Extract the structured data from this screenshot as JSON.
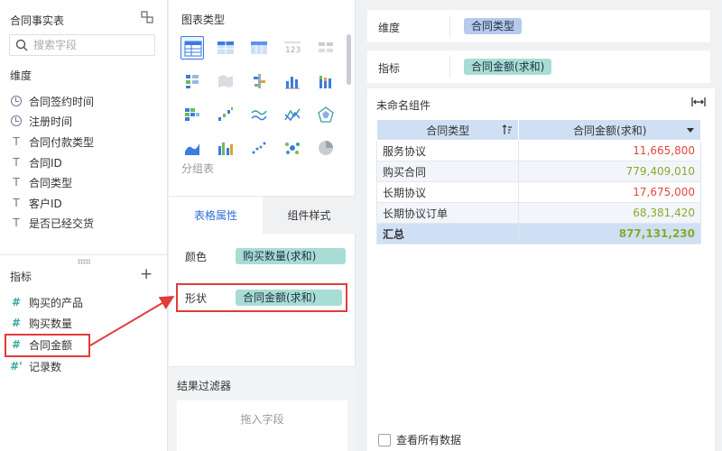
{
  "left": {
    "title": "合同事实表",
    "search_placeholder": "搜索字段",
    "dimension_label": "维度",
    "dimensions": [
      {
        "icon": "clock-icon",
        "label": "合同签约时间"
      },
      {
        "icon": "clock-icon",
        "label": "注册时间"
      },
      {
        "icon": "text-type-icon",
        "label": "合同付款类型"
      },
      {
        "icon": "text-type-icon",
        "label": "合同ID"
      },
      {
        "icon": "text-type-icon",
        "label": "合同类型"
      },
      {
        "icon": "text-type-icon",
        "label": "客户ID"
      },
      {
        "icon": "text-type-icon",
        "label": "是否已经交货"
      }
    ],
    "measure_label": "指标",
    "measures": [
      {
        "icon": "number-type-icon",
        "label": "购买的产品"
      },
      {
        "icon": "number-type-icon",
        "label": "购买数量"
      },
      {
        "icon": "number-type-icon",
        "label": "合同金额"
      },
      {
        "icon": "count-type-icon",
        "label": "记录数"
      }
    ]
  },
  "middle": {
    "chart_type_label": "图表类型",
    "more_label": "分组表",
    "tabs": {
      "active": "表格属性",
      "inactive": "组件样式"
    },
    "color_label": "颜色",
    "color_field": "购买数量(求和)",
    "shape_label": "形状",
    "shape_field": "合同金额(求和)",
    "filter_title": "结果过滤器",
    "filter_drop": "拖入字段"
  },
  "right": {
    "dimension_label": "维度",
    "dimension_field": "合同类型",
    "measure_label": "指标",
    "measure_field": "合同金额(求和)",
    "component_title": "未命名组件",
    "table": {
      "headers": [
        "合同类型",
        "合同金额(求和)"
      ],
      "rows": [
        {
          "type": "服务协议",
          "amount": "11,665,800",
          "color": "#e0473a"
        },
        {
          "type": "购买合同",
          "amount": "779,409,010",
          "color": "#8aa92a"
        },
        {
          "type": "长期协议",
          "amount": "17,675,000",
          "color": "#e0473a"
        },
        {
          "type": "长期协议订单",
          "amount": "68,381,420",
          "color": "#8aa92a"
        }
      ],
      "total": {
        "label": "汇总",
        "amount": "877,131,230",
        "color": "#8aa92a"
      }
    },
    "view_all_label": "查看所有数据"
  },
  "colors": {
    "accent": "#3c7be0",
    "highlight": "#e23b3b",
    "pill_green": "#a8ddd5",
    "pill_blue": "#b7c9ec"
  }
}
